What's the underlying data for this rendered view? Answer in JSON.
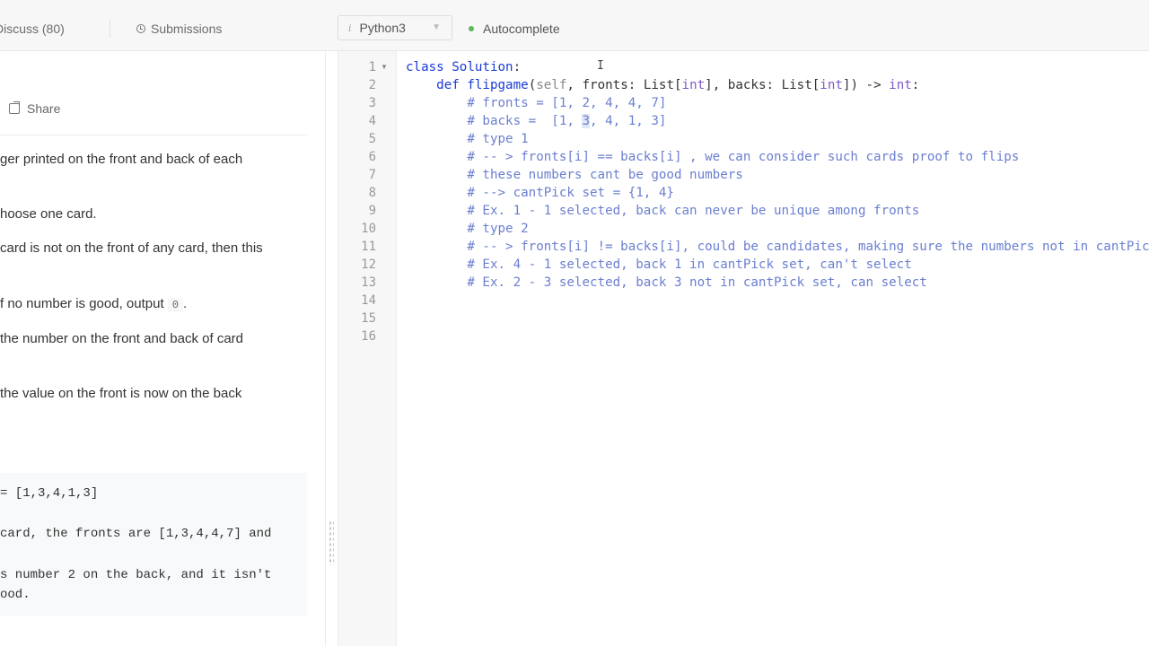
{
  "topbar": {
    "discuss_label": "Discuss (80)",
    "submissions_label": "Submissions",
    "language_selected": "Python3",
    "autocomplete_label": "Autocomplete"
  },
  "left": {
    "share_label": "Share",
    "desc_lines": [
      "ger printed on the front and back of each",
      "hoose one card.",
      "card is not on the front of any card, then this",
      "f no number is good, output",
      "the number on the front and back of card",
      " the value on the front is now on the back"
    ],
    "output_value": "0",
    "output_suffix": ".",
    "example_lines": [
      "= [1,3,4,1,3]",
      "card, the fronts are [1,3,4,4,7] and",
      "s number 2 on the back, and it isn't",
      "ood."
    ]
  },
  "editor": {
    "line_numbers": [
      "1",
      "2",
      "3",
      "4",
      "5",
      "6",
      "7",
      "8",
      "9",
      "10",
      "11",
      "12",
      "13",
      "14",
      "15",
      "16"
    ],
    "line1_kw": "class",
    "line1_name": "Solution",
    "line1_colon": ":",
    "line2_def": "def",
    "line2_fn": "flipgame",
    "line2_self": "self",
    "line2_a": ", fronts: List[",
    "line2_int1": "int",
    "line2_b": "], backs: List[",
    "line2_int2": "int",
    "line2_c": "]) -> ",
    "line2_int3": "int",
    "line2_end": ":",
    "line4_pre": "# backs =  [1, ",
    "line4_hl": "3",
    "line4_post": ", 4, 1, 3]",
    "comments": {
      "3": "# fronts = [1, 2, 4, 4, 7]",
      "5": "# type 1",
      "6": "# -- > fronts[i] == backs[i] , we can consider such cards proof to flips",
      "7": "# these numbers cant be good numbers",
      "8": "# --> cantPick set = {1, 4}",
      "9": "# Ex. 1 - 1 selected, back can never be unique among fronts",
      "10": "# type 2",
      "11": "# -- > fronts[i] != backs[i], could be candidates, making sure the numbers not in cantPick",
      "12": "# Ex. 4 - 1 selected, back 1 in cantPick set, can't select",
      "13": "# Ex. 2 - 3 selected, back 3 not in cantPick set, can select"
    }
  },
  "icons": {
    "clock": "clock-icon",
    "info": "info-icon",
    "chevron": "chevron-down-icon",
    "status": "green-dot-icon",
    "share": "share-icon",
    "fold": "fold-arrow-icon"
  },
  "colors": {
    "keyword": "#1a3bd8",
    "comment": "#6b7fd0",
    "type": "#7d5bc4",
    "status_green": "#5cb85c"
  }
}
